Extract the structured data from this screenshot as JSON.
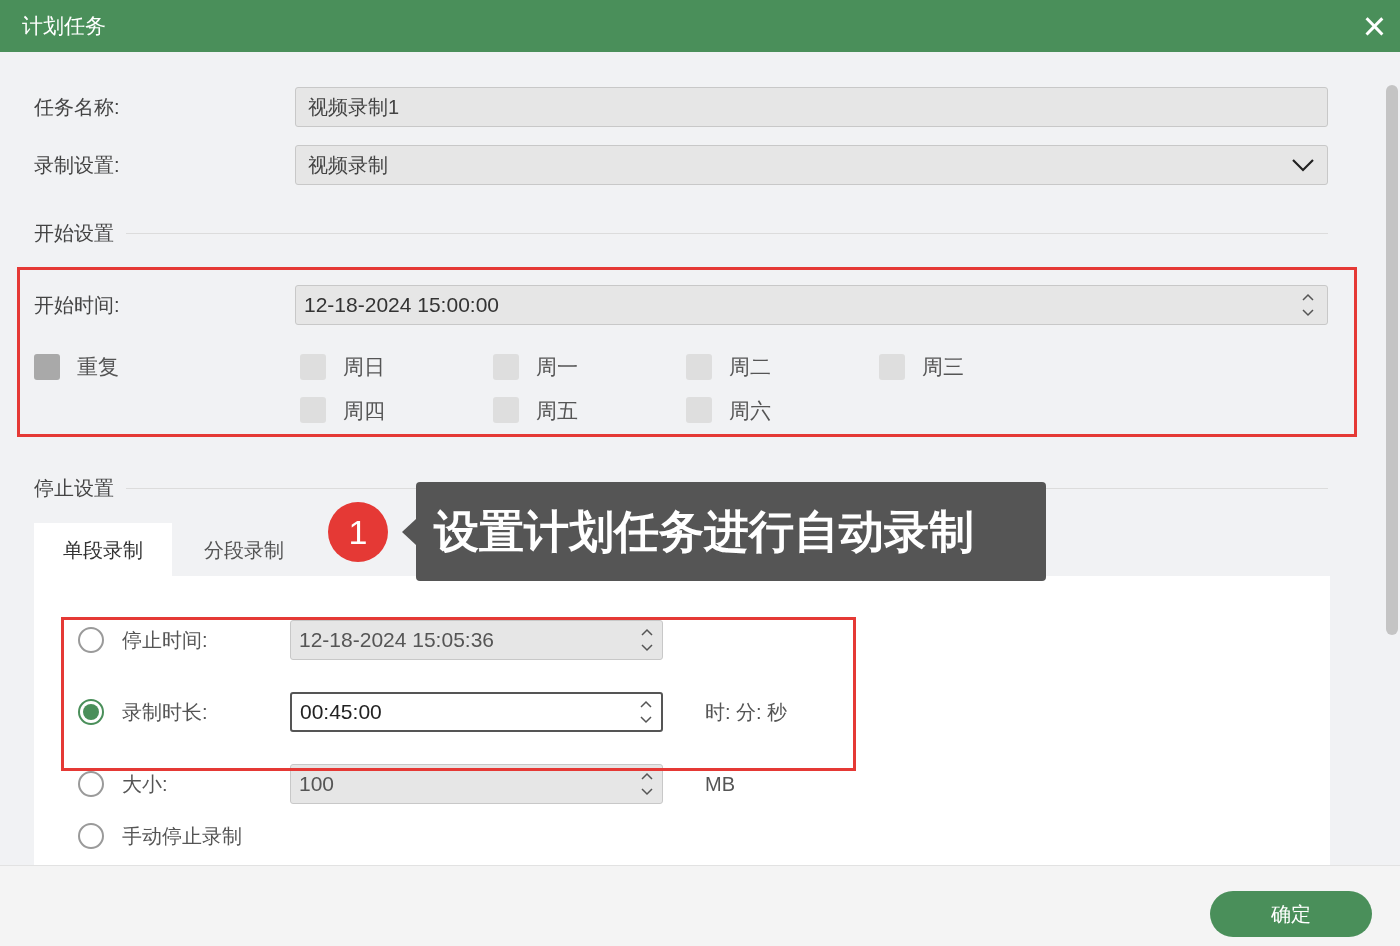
{
  "window": {
    "title": "计划任务",
    "close": "×"
  },
  "fields": [
    {
      "label": "任务名称:",
      "kind": "text",
      "value": "视频录制1"
    },
    {
      "label": "录制设置:",
      "kind": "select",
      "value": "视频录制"
    }
  ],
  "start_section": {
    "title": "开始设置",
    "start_time": {
      "label": "开始时间:",
      "value": "12-18-2024 15:00:00"
    },
    "repeat": {
      "label": "重复",
      "checked": false,
      "disabled": true
    },
    "days": [
      {
        "label": "周日",
        "checked": false
      },
      {
        "label": "周一",
        "checked": false
      },
      {
        "label": "周二",
        "checked": false
      },
      {
        "label": "周三",
        "checked": false
      },
      {
        "label": "周四",
        "checked": false
      },
      {
        "label": "周五",
        "checked": false
      },
      {
        "label": "周六",
        "checked": false
      }
    ]
  },
  "stop_section": {
    "title": "停止设置",
    "tabs": [
      {
        "label": "单段录制",
        "selected": true
      },
      {
        "label": "分段录制",
        "selected": false
      }
    ],
    "options": [
      {
        "label": "停止时间:",
        "selected": false,
        "value": "12-18-2024 15:05:36"
      },
      {
        "label": "录制时长:",
        "selected": true,
        "value": "00:45:00",
        "unit": "时: 分: 秒"
      },
      {
        "label": "大小:",
        "selected": false,
        "value": "100",
        "unit": "MB"
      },
      {
        "label": "手动停止录制",
        "selected": false
      }
    ]
  },
  "callout": {
    "number": "1",
    "text": "设置计划任务进行自动录制"
  },
  "buttons": [
    "确定"
  ]
}
